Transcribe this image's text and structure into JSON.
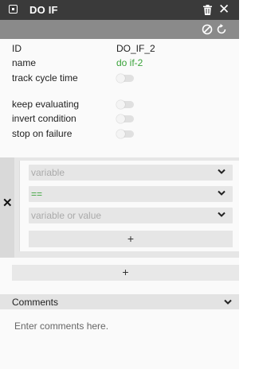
{
  "header": {
    "title": "DO IF",
    "title_icon": "node-icon",
    "actions": [
      "trash-icon",
      "close-icon"
    ],
    "bg": "#3a3a3a"
  },
  "toolbar": {
    "icons": [
      "disable-icon",
      "reset-icon"
    ],
    "bg": "#8a8a8a"
  },
  "props": {
    "id_label": "ID",
    "id_value": "DO_IF_2",
    "name_label": "name",
    "name_value": "do if-2",
    "track_label": "track cycle time",
    "keep_label": "keep evaluating",
    "invert_label": "invert condition",
    "stop_label": "stop on failure"
  },
  "condition": {
    "remove_label": "✕",
    "left_placeholder": "variable",
    "operator": "==",
    "right_placeholder": "variable or value",
    "add_label": "+"
  },
  "add_condition_label": "+",
  "comments": {
    "title": "Comments",
    "placeholder": "Enter comments here."
  },
  "colors": {
    "accent_green": "#3aa33a"
  }
}
